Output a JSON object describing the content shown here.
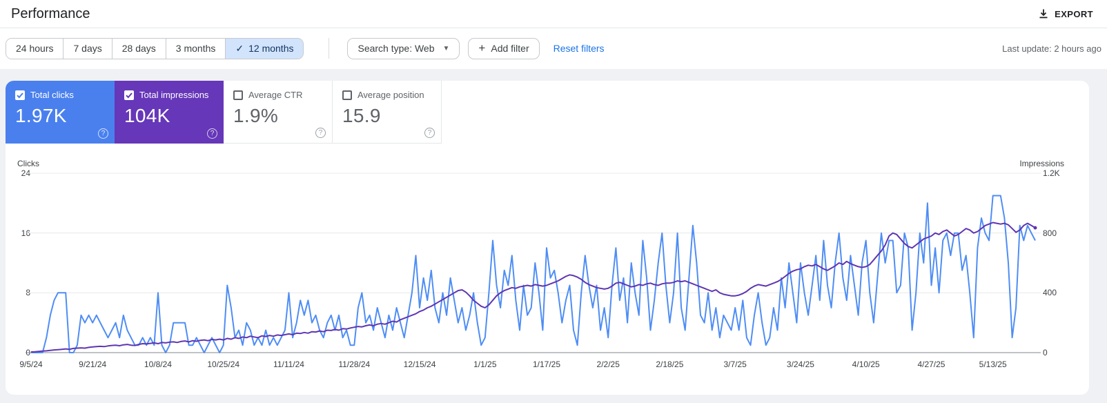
{
  "header": {
    "title": "Performance",
    "export_label": "EXPORT"
  },
  "filters": {
    "date_ranges": [
      {
        "label": "24 hours",
        "selected": false
      },
      {
        "label": "7 days",
        "selected": false
      },
      {
        "label": "28 days",
        "selected": false
      },
      {
        "label": "3 months",
        "selected": false
      },
      {
        "label": "12 months",
        "selected": true
      }
    ],
    "selected_check": "✓",
    "search_type_label": "Search type: Web",
    "add_filter_label": "Add filter",
    "reset_filters_label": "Reset filters",
    "last_update": "Last update: 2 hours ago"
  },
  "metrics": [
    {
      "label": "Total clicks",
      "value": "1.97K",
      "checked": true,
      "color": "#4a80ee",
      "help_icon": "?"
    },
    {
      "label": "Total impressions",
      "value": "104K",
      "checked": true,
      "color": "#6637b8",
      "help_icon": "?"
    },
    {
      "label": "Average CTR",
      "value": "1.9%",
      "checked": false,
      "color": "#ffffff",
      "help_icon": "?"
    },
    {
      "label": "Average position",
      "value": "15.9",
      "checked": false,
      "color": "#ffffff",
      "help_icon": "?"
    }
  ],
  "chart_data": {
    "type": "line",
    "left_axis": {
      "title": "Clicks",
      "ticks": [
        "24",
        "16",
        "8",
        "0"
      ],
      "max": 24
    },
    "right_axis": {
      "title": "Impressions",
      "ticks": [
        "1.2K",
        "800",
        "400",
        "0"
      ],
      "max": 1200
    },
    "grid": "horizontal",
    "legend_position": "none",
    "x_labels": [
      "9/5/24",
      "9/21/24",
      "10/8/24",
      "10/25/24",
      "11/11/24",
      "11/28/24",
      "12/15/24",
      "1/1/25",
      "1/17/25",
      "2/2/25",
      "2/18/25",
      "3/7/25",
      "3/24/25",
      "4/10/25",
      "4/27/25",
      "5/13/25"
    ],
    "x_label_days": [
      0,
      16,
      33,
      50,
      67,
      84,
      101,
      118,
      134,
      150,
      166,
      183,
      200,
      217,
      234,
      250
    ],
    "series": [
      {
        "name": "Clicks",
        "axis": "left",
        "color": "#4e8df5",
        "values": [
          0,
          0,
          0,
          0,
          2,
          5,
          7,
          8,
          8,
          8,
          0,
          0,
          1,
          5,
          4,
          5,
          4,
          5,
          4,
          3,
          2,
          3,
          4,
          2,
          5,
          3,
          2,
          1,
          1,
          2,
          1,
          2,
          1,
          8,
          1,
          0,
          1,
          4,
          4,
          4,
          4,
          1,
          1,
          2,
          1,
          0,
          1,
          2,
          1,
          0,
          1,
          9,
          6,
          2,
          3,
          1,
          4,
          3,
          1,
          2,
          1,
          3,
          1,
          2,
          1,
          2,
          3,
          8,
          2,
          4,
          7,
          5,
          7,
          4,
          5,
          3,
          2,
          4,
          5,
          3,
          5,
          2,
          3,
          1,
          1,
          6,
          8,
          4,
          5,
          3,
          6,
          4,
          2,
          5,
          3,
          6,
          4,
          2,
          5,
          8,
          13,
          6,
          10,
          7,
          11,
          6,
          4,
          8,
          5,
          10,
          7,
          4,
          6,
          3,
          5,
          8,
          4,
          1,
          2,
          8,
          15,
          9,
          6,
          11,
          9,
          13,
          7,
          3,
          9,
          5,
          6,
          12,
          8,
          3,
          14,
          10,
          11,
          8,
          4,
          7,
          9,
          3,
          1,
          8,
          13,
          9,
          6,
          9,
          3,
          6,
          2,
          9,
          14,
          7,
          10,
          4,
          12,
          8,
          5,
          15,
          10,
          3,
          7,
          12,
          16,
          9,
          4,
          8,
          16,
          6,
          3,
          10,
          17,
          12,
          5,
          4,
          8,
          3,
          6,
          2,
          5,
          4,
          3,
          6,
          3,
          7,
          2,
          1,
          5,
          8,
          4,
          1,
          2,
          6,
          3,
          10,
          6,
          12,
          8,
          4,
          12,
          8,
          5,
          9,
          13,
          7,
          15,
          9,
          6,
          12,
          16,
          10,
          7,
          13,
          9,
          5,
          12,
          15,
          8,
          4,
          10,
          16,
          12,
          15,
          15,
          8,
          9,
          16,
          14,
          3,
          8,
          16,
          12,
          20,
          9,
          14,
          8,
          15,
          16,
          13,
          16,
          16,
          11,
          13,
          8,
          2,
          14,
          18,
          16,
          15,
          21,
          21,
          21,
          18,
          12,
          2,
          6,
          17,
          15,
          17,
          16,
          15
        ]
      },
      {
        "name": "Impressions",
        "axis": "right",
        "color": "#5e35b1",
        "values": [
          5,
          6,
          8,
          10,
          12,
          15,
          18,
          20,
          22,
          25,
          22,
          28,
          30,
          32,
          30,
          35,
          38,
          40,
          42,
          40,
          45,
          48,
          50,
          46,
          52,
          55,
          50,
          48,
          55,
          60,
          58,
          62,
          65,
          60,
          68,
          65,
          70,
          72,
          68,
          75,
          78,
          72,
          80,
          76,
          82,
          85,
          80,
          88,
          85,
          90,
          85,
          95,
          90,
          100,
          95,
          105,
          100,
          110,
          105,
          100,
          112,
          108,
          115,
          110,
          118,
          115,
          120,
          125,
          120,
          130,
          128,
          135,
          130,
          140,
          138,
          145,
          140,
          150,
          148,
          155,
          150,
          160,
          158,
          165,
          170,
          175,
          172,
          180,
          185,
          180,
          190,
          195,
          190,
          200,
          210,
          205,
          220,
          230,
          240,
          250,
          260,
          275,
          285,
          300,
          310,
          325,
          340,
          355,
          370,
          385,
          400,
          415,
          420,
          405,
          380,
          350,
          330,
          310,
          300,
          320,
          350,
          380,
          400,
          415,
          425,
          435,
          430,
          440,
          445,
          450,
          445,
          455,
          450,
          445,
          450,
          460,
          470,
          480,
          495,
          510,
          520,
          515,
          505,
          490,
          470,
          455,
          445,
          435,
          430,
          425,
          430,
          445,
          465,
          470,
          460,
          450,
          440,
          445,
          455,
          450,
          460,
          465,
          455,
          450,
          460,
          465,
          465,
          470,
          480,
          475,
          480,
          470,
          460,
          450,
          440,
          430,
          420,
          410,
          420,
          400,
          390,
          385,
          380,
          380,
          385,
          395,
          410,
          430,
          445,
          455,
          450,
          445,
          455,
          465,
          475,
          490,
          510,
          530,
          545,
          555,
          560,
          575,
          585,
          580,
          590,
          575,
          560,
          550,
          565,
          580,
          600,
          590,
          610,
          595,
          585,
          575,
          570,
          575,
          590,
          620,
          650,
          680,
          720,
          780,
          800,
          790,
          760,
          730,
          710,
          700,
          720,
          740,
          760,
          770,
          780,
          800,
          790,
          810,
          820,
          800,
          780,
          790,
          810,
          830,
          820,
          800,
          810,
          830,
          850,
          860,
          870,
          865,
          860,
          865,
          855,
          830,
          805,
          820,
          850,
          865,
          850,
          835
        ]
      }
    ]
  }
}
